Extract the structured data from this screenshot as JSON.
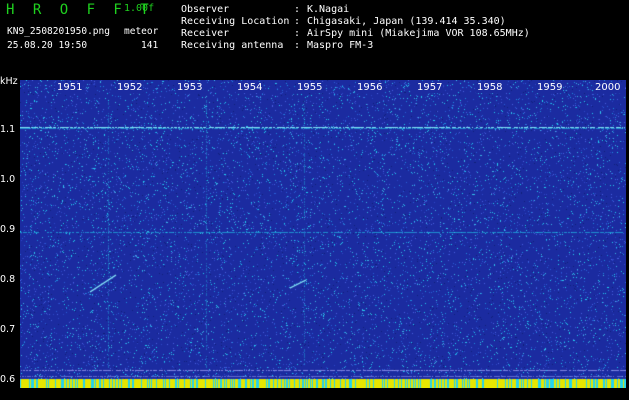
{
  "header": {
    "brand": "H R O F F T",
    "version": "1.00f",
    "filename": "KN9_2508201950.png",
    "mode": "meteor",
    "datetime": "25.08.20 19:50",
    "count": "141",
    "fields": [
      {
        "key": "Observer",
        "value": "K.Nagai"
      },
      {
        "key": "Receiving Location",
        "value": "Chigasaki, Japan (139.414 35.340)"
      },
      {
        "key": "Receiver",
        "value": "AirSpy mini (Miakejima VOR 108.65MHz)"
      },
      {
        "key": "Receiving antenna",
        "value": "Maspro FM-3"
      }
    ]
  },
  "plot": {
    "y_unit": "kHz",
    "y_ticks": [
      "1.1",
      "1.0",
      "0.9",
      "0.8",
      "0.7",
      "0.6"
    ],
    "x_ticks": [
      "1951",
      "1952",
      "1953",
      "1954",
      "1955",
      "1956",
      "1957",
      "1958",
      "1959",
      "2000"
    ],
    "colors": {
      "background": "#1b2ba0",
      "noise": "#22d3f0",
      "signal": "#8ef5ff",
      "bottom_bar": "#e6e600"
    }
  }
}
